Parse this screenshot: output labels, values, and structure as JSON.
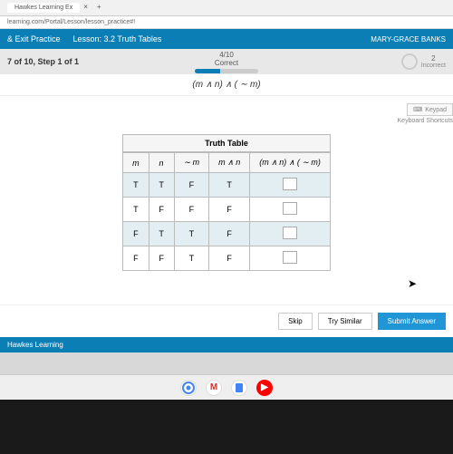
{
  "browser": {
    "tab_title": "Hawkes Learning Ex",
    "url": "learning.com/Portal/Lesson/lesson_practice#!"
  },
  "header": {
    "exit_practice": "& Exit Practice",
    "lesson": "Lesson: 3.2 Truth Tables",
    "user": "MARY-GRACE BANKS"
  },
  "subheader": {
    "step": "7 of 10, Step 1 of 1",
    "progress_fraction": "4/10",
    "progress_label": "Correct",
    "status_count": "2",
    "status_label": "Incorrect"
  },
  "expression": "(m ∧ n) ∧ ( ∼ m)",
  "keypad": {
    "button": "Keypad",
    "shortcuts": "Keyboard Shortcuts"
  },
  "table": {
    "caption": "Truth Table",
    "headers": [
      "m",
      "n",
      "∼ m",
      "m ∧ n",
      "(m ∧ n) ∧ ( ∼ m)"
    ],
    "rows": [
      [
        "T",
        "T",
        "F",
        "T",
        ""
      ],
      [
        "T",
        "F",
        "F",
        "F",
        ""
      ],
      [
        "F",
        "T",
        "T",
        "F",
        ""
      ],
      [
        "F",
        "F",
        "T",
        "F",
        ""
      ]
    ]
  },
  "actions": {
    "skip": "Skip",
    "try_similar": "Try Similar",
    "submit": "Submit Answer"
  },
  "footer": {
    "brand": "Hawkes Learning"
  }
}
